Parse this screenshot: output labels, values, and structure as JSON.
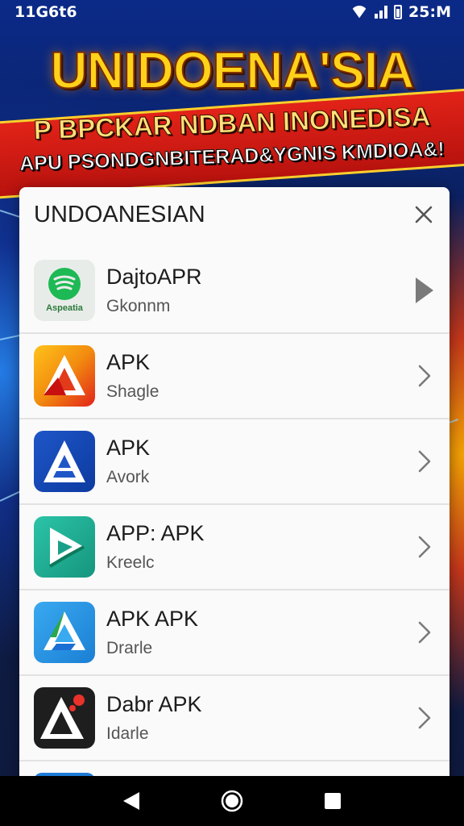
{
  "status_bar": {
    "left_text": "11G6t6",
    "time": "25:M"
  },
  "banner": {
    "title": "UNIDOENA'SIA",
    "line1": "P BPCKAR NDBAN INONEDISA",
    "line2": "APU PSONDGNBITERAD&YGNIS KMDIOA&!"
  },
  "dialog": {
    "title": "UNDOANESIAN",
    "close_icon": "close-icon",
    "items": [
      {
        "name": "DajtoAPR",
        "subtitle": "Gkonnm",
        "icon_label": "Aspeatia",
        "icon": "spotify-like-icon"
      },
      {
        "name": "APK",
        "subtitle": "Shagle",
        "icon": "triangle-a-icon"
      },
      {
        "name": "APK",
        "subtitle": "Avork",
        "icon": "triangle-a-icon"
      },
      {
        "name": "APP: APK",
        "subtitle": "Kreelc",
        "icon": "play-triangle-icon"
      },
      {
        "name": "APK APK",
        "subtitle": "Drarle",
        "icon": "drive-triangle-icon"
      },
      {
        "name": "Dabr APK",
        "subtitle": "Idarle",
        "icon": "triangle-a-icon"
      }
    ]
  },
  "colors": {
    "banner_yellow": "#ffd21a",
    "ribbon_red": "#d31b14",
    "dialog_bg": "#fafafa",
    "nav_bg": "#000000"
  },
  "nav": {
    "back_icon": "back-icon",
    "home_icon": "home-icon",
    "recents_icon": "recents-icon"
  }
}
